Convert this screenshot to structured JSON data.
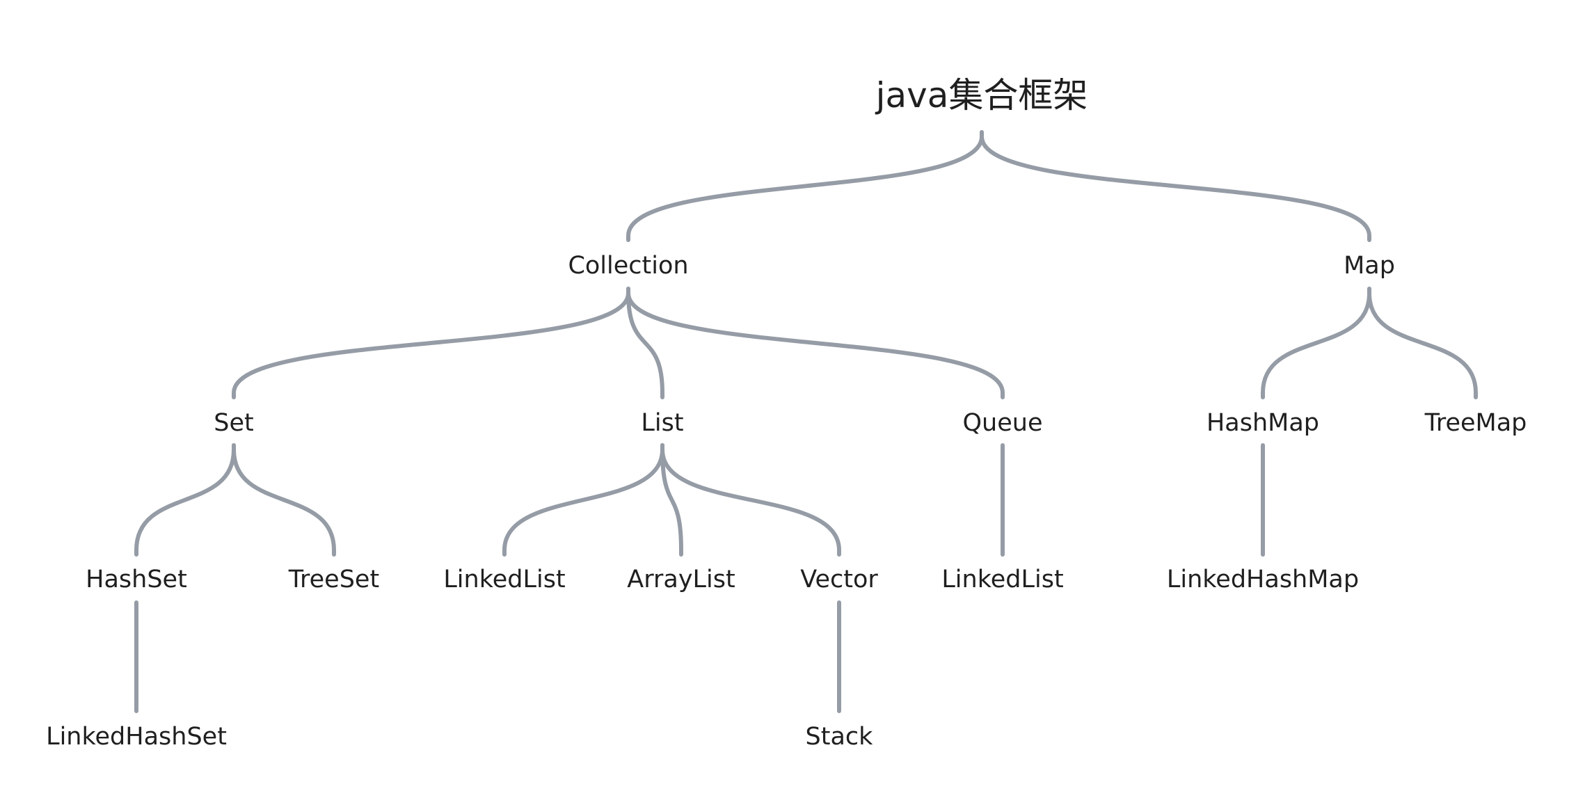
{
  "tree": {
    "root": "java集合框架",
    "nodes": {
      "collection": "Collection",
      "map": "Map",
      "set": "Set",
      "list": "List",
      "queue": "Queue",
      "hashmap": "HashMap",
      "treemap": "TreeMap",
      "hashset": "HashSet",
      "treeset": "TreeSet",
      "list_linkedlist": "LinkedList",
      "arraylist": "ArrayList",
      "vector": "Vector",
      "queue_linkedlist": "LinkedList",
      "linkedhashmap": "LinkedHashMap",
      "linkedhashset": "LinkedHashSet",
      "stack": "Stack"
    },
    "edges": [
      [
        "root",
        "collection"
      ],
      [
        "root",
        "map"
      ],
      [
        "collection",
        "set"
      ],
      [
        "collection",
        "list"
      ],
      [
        "collection",
        "queue"
      ],
      [
        "map",
        "hashmap"
      ],
      [
        "map",
        "treemap"
      ],
      [
        "set",
        "hashset"
      ],
      [
        "set",
        "treeset"
      ],
      [
        "list",
        "list_linkedlist"
      ],
      [
        "list",
        "arraylist"
      ],
      [
        "list",
        "vector"
      ],
      [
        "queue",
        "queue_linkedlist"
      ],
      [
        "hashmap",
        "linkedhashmap"
      ],
      [
        "hashset",
        "linkedhashset"
      ],
      [
        "vector",
        "stack"
      ]
    ]
  },
  "colors": {
    "edge": "#959ca6",
    "text": "#1f1f1f",
    "background": "#ffffff"
  }
}
